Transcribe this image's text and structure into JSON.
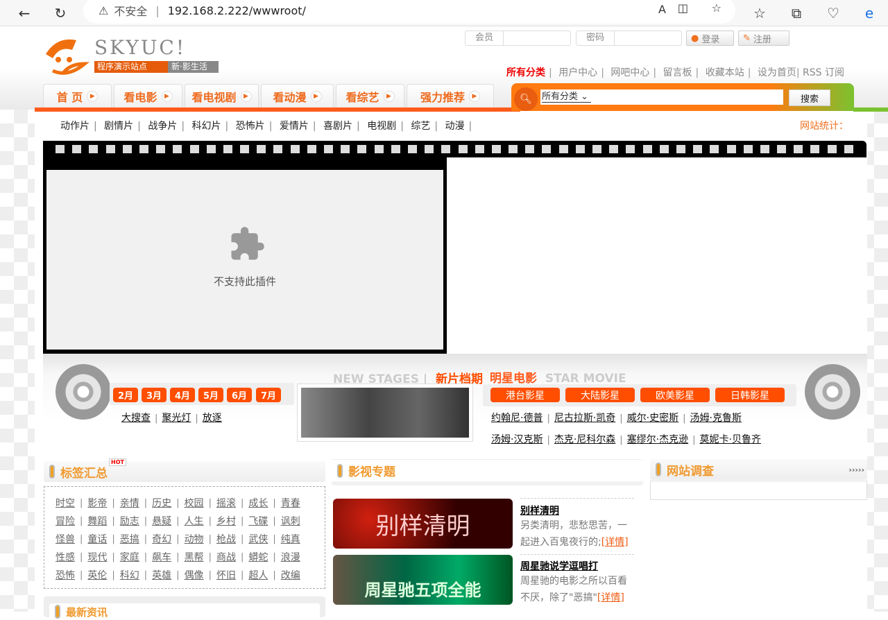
{
  "browser": {
    "insecure_label": "不安全",
    "url": "192.168.2.222/wwwroot/"
  },
  "logo": {
    "name": "SKYUC!",
    "tagline1": "程序演示站点",
    "tagline2": "新·影生活"
  },
  "login": {
    "member_label": "会员",
    "password_label": "密码",
    "login_button": "登录",
    "register_button": "注册"
  },
  "top_links": [
    "所有分类",
    "用户中心",
    "网吧中心",
    "留言板",
    "收藏本站",
    "设为首页",
    "RSS 订阅"
  ],
  "tabs": [
    "首 页",
    "看电影",
    "看电视剧",
    "看动漫",
    "看综艺",
    "强力推荐"
  ],
  "search": {
    "category": "所有分类",
    "button": "搜索"
  },
  "subnav": [
    "动作片",
    "剧情片",
    "战争片",
    "科幻片",
    "恐怖片",
    "爱情片",
    "喜剧片",
    "电视剧",
    "综艺",
    "动漫"
  ],
  "stats_label": "网站统计：",
  "plugin": {
    "message": "不支持此插件"
  },
  "new_stages": {
    "title_en": "NEW STAGES",
    "title_cn": "新片档期",
    "months": [
      "2月",
      "3月",
      "4月",
      "5月",
      "6月",
      "7月"
    ],
    "links": [
      "大搜查",
      "聚光灯",
      "放逐"
    ]
  },
  "star_movie": {
    "title_cn": "明星电影",
    "title_en": "STAR MOVIE",
    "tabs": [
      "港台影星",
      "大陆影星",
      "欧美影星",
      "日韩影星"
    ],
    "row1": [
      "约翰尼·德普",
      "尼古拉斯·凯奇",
      "威尔·史密斯",
      "汤姆·克鲁斯"
    ],
    "row2": [
      "汤姆·汉克斯",
      "杰克·尼科尔森",
      "塞缪尔·杰克逊",
      "莫妮卡·贝鲁齐"
    ]
  },
  "tags": {
    "title": "标签汇总",
    "hot": "HOT",
    "rows": [
      [
        "时空",
        "影帝",
        "亲情",
        "历史",
        "校园",
        "摇滚",
        "成长",
        "青春"
      ],
      [
        "冒险",
        "舞蹈",
        "励志",
        "悬疑",
        "人生",
        "乡村",
        "飞碟",
        "讽刺"
      ],
      [
        "怪兽",
        "童话",
        "恶搞",
        "奇幻",
        "动物",
        "枪战",
        "武侠",
        "纯真"
      ],
      [
        "性感",
        "现代",
        "家庭",
        "飙车",
        "黑帮",
        "商战",
        "蟒蛇",
        "浪漫"
      ],
      [
        "恐怖",
        "英伦",
        "科幻",
        "英雄",
        "偶像",
        "怀旧",
        "超人",
        "改编"
      ]
    ]
  },
  "news_title": "最新资讯",
  "topics": {
    "title": "影视专题",
    "items": [
      {
        "title": "别样清明",
        "image_text": "别样清明",
        "desc1": "另类清明，悲愁思苦，一",
        "desc2": "起进入百鬼夜行的;",
        "more": "[详情]"
      },
      {
        "title": "周星驰说学逗唱打",
        "image_text": "周星驰五项全能",
        "desc1": "周星驰的电影之所以百看",
        "desc2": "不厌，除了\"恶搞\"",
        "more": "[详情]"
      }
    ]
  },
  "survey": {
    "title": "网站调查",
    "more": "›››››"
  }
}
